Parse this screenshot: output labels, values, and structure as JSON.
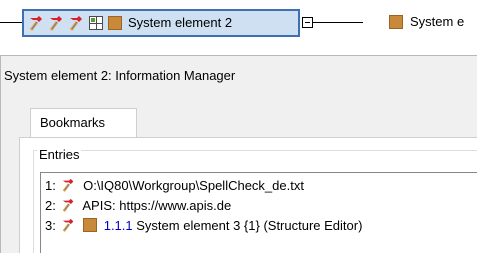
{
  "structure": {
    "selected_node": {
      "label": "System element 2"
    },
    "next_node": {
      "label": "System e"
    }
  },
  "dialog": {
    "title": "System element 2: Information Manager",
    "tabs": [
      {
        "label": "Bookmarks",
        "selected": true
      }
    ],
    "group_label": "Entries",
    "entries": [
      {
        "index": "1:",
        "icon": "hammer-red-icon",
        "text": "O:\\IQ80\\Workgroup\\SpellCheck_de.txt"
      },
      {
        "index": "2:",
        "icon": "hammer-red-icon",
        "text": "APIS: https://www.apis.de"
      },
      {
        "index": "3:",
        "icon": "hammer-red-icon",
        "number": "1.1.1",
        "text": "System element 3 {1} (Structure Editor)"
      }
    ]
  },
  "colors": {
    "selection_fill": "#cfe0f3",
    "selection_border": "#3d6fb3",
    "element_brown": "#c8893a",
    "hammer_red": "#d8202a",
    "hammer_orange": "#f0a030",
    "link_blue": "#0000cc"
  }
}
